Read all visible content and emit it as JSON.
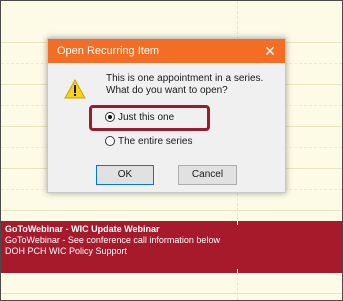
{
  "dialog": {
    "title": "Open Recurring Item",
    "close_glyph": "✕",
    "message_line1": "This is one appointment in a series.",
    "message_line2": "What do you want to open?",
    "options": [
      {
        "label": "Just this one",
        "checked": true
      },
      {
        "label": "The entire series",
        "checked": false
      }
    ],
    "ok_label": "OK",
    "cancel_label": "Cancel",
    "icon": "warning-icon",
    "title_color": "#f36d24",
    "highlight_color": "#9b1b30"
  },
  "event": {
    "line1": "GoToWebinar - WIC Update Webinar",
    "line2": "GoToWebinar - See conference call information below",
    "line3": "DOH PCH WIC Policy Support",
    "color": "#a61a2c"
  }
}
